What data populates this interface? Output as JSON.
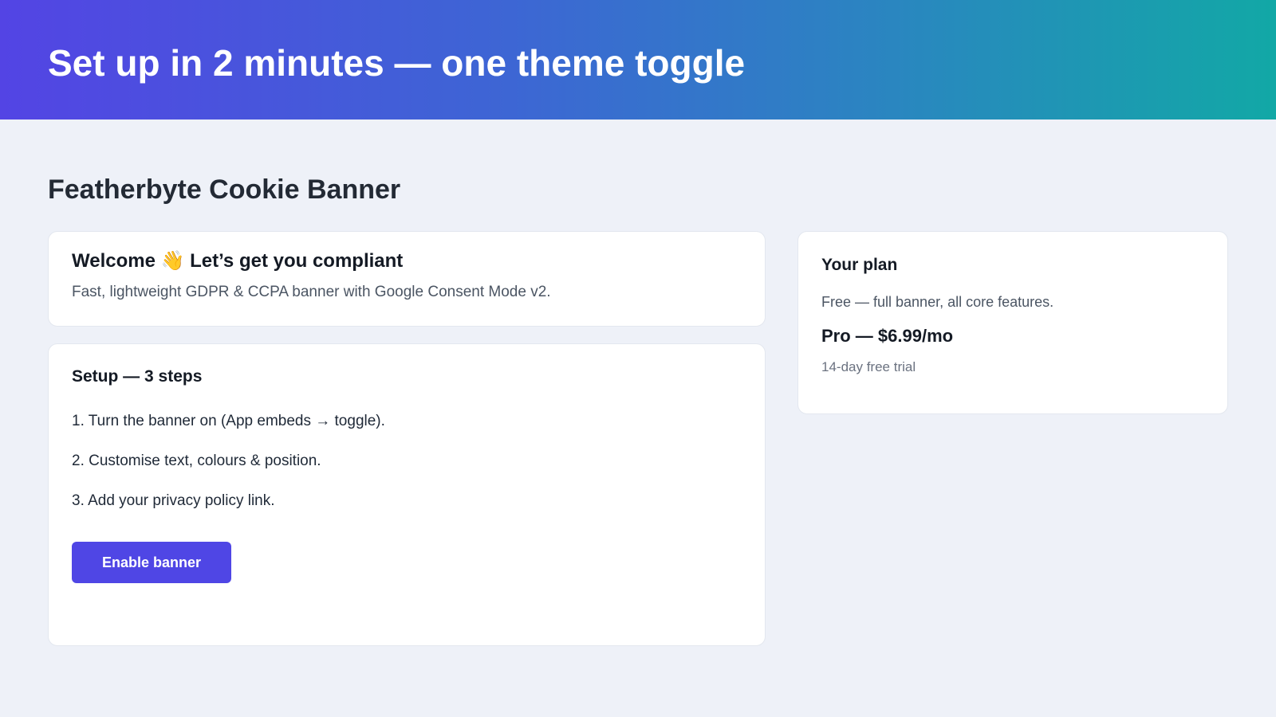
{
  "hero": {
    "title": "Set up in 2 minutes — one theme toggle"
  },
  "page": {
    "title": "Featherbyte Cookie Banner"
  },
  "welcome": {
    "heading": "Welcome 👋 Let’s get you compliant",
    "subtitle": "Fast, lightweight GDPR & CCPA banner with Google Consent Mode v2."
  },
  "setup": {
    "heading": "Setup — 3 steps",
    "steps": [
      "1. Turn the banner on (App embeds → toggle).",
      "2. Customise text, colours & position.",
      "3. Add your privacy policy link."
    ],
    "button_label": "Enable banner"
  },
  "plan": {
    "heading": "Your plan",
    "free_text": "Free — full banner, all core features.",
    "pro_text": "Pro — $6.99/mo",
    "trial_text": "14-day free trial"
  },
  "colors": {
    "accent": "#4f46e5",
    "hero_gradient_start": "#5344e4",
    "hero_gradient_end": "#12a8a6",
    "background": "#eef1f8"
  }
}
